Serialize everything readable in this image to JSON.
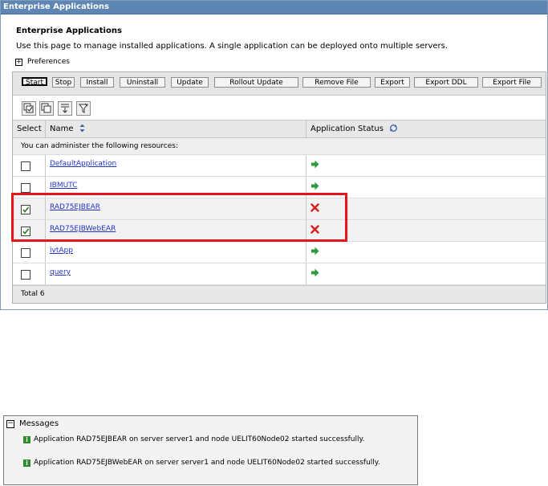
{
  "window": {
    "title": "Enterprise Applications"
  },
  "page": {
    "title": "Enterprise Applications",
    "description": "Use this page to manage installed applications. A single application can be deployed onto multiple servers.",
    "preferences_label": "Preferences"
  },
  "toolbar": {
    "buttons": [
      "Start",
      "Stop",
      "Install",
      "Uninstall",
      "Update",
      "Rollout Update",
      "Remove File",
      "Export",
      "Export DDL",
      "Export File"
    ]
  },
  "icon_toolbar": [
    "select-all-icon",
    "deselect-all-icon",
    "show-filter-icon",
    "clear-filter-icon"
  ],
  "table": {
    "headers": {
      "select": "Select",
      "name": "Name",
      "status": "Application Status"
    },
    "resources_note": "You can administer the following resources:",
    "rows": [
      {
        "name": "DefaultApplication",
        "checked": false,
        "status": "started"
      },
      {
        "name": "IBMUTC",
        "checked": false,
        "status": "started"
      },
      {
        "name": "RAD75EJBEAR",
        "checked": true,
        "status": "stopped"
      },
      {
        "name": "RAD75EJBWebEAR",
        "checked": true,
        "status": "stopped"
      },
      {
        "name": "ivtApp",
        "checked": false,
        "status": "started"
      },
      {
        "name": "query",
        "checked": false,
        "status": "started"
      }
    ],
    "total": "Total 6"
  },
  "colors": {
    "started": "#2e9b3e",
    "stopped": "#d22020",
    "highlight": "#e8141c",
    "title_bar": "#5d86b5"
  },
  "messages": {
    "title": "Messages",
    "items": [
      "Application RAD75EJBEAR on server server1 and node UELIT60Node02 started successfully.",
      "Application RAD75EJBWebEAR on server server1 and node UELIT60Node02 started successfully."
    ]
  }
}
